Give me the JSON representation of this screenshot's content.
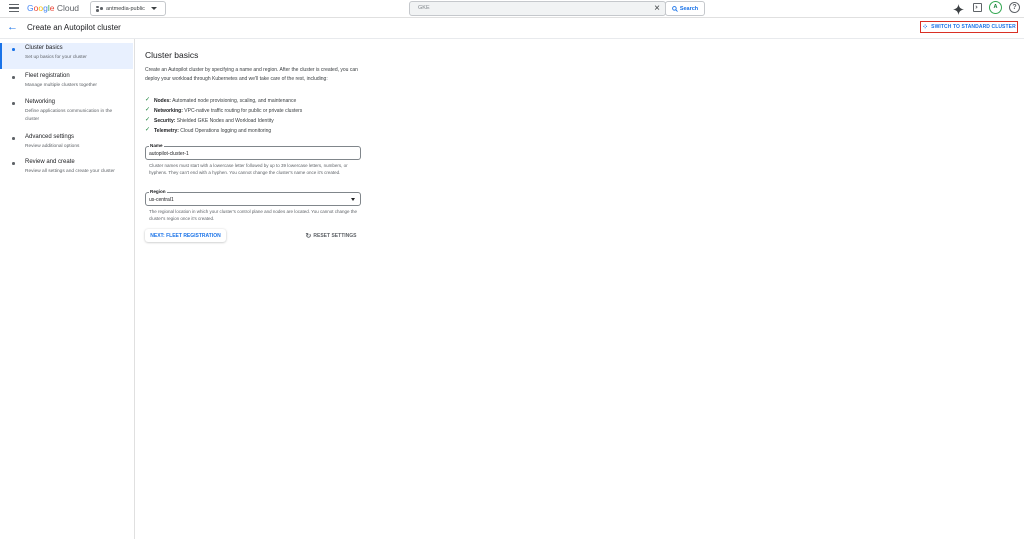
{
  "topbar": {
    "logo": {
      "g1": "G",
      "g2": "o",
      "g3": "o",
      "g4": "g",
      "g5": "l",
      "g6": "e",
      "cloud": "Cloud"
    },
    "project": "antmedia-public",
    "search_value": "GKE",
    "search_button": "Search",
    "avatar_letter": "A",
    "help_glyph": "?"
  },
  "titlebar": {
    "back_glyph": "←",
    "title": "Create an Autopilot cluster",
    "switch_button": "SWITCH TO STANDARD CLUSTER"
  },
  "steps": [
    {
      "title": "Cluster basics",
      "desc": "Set up basics for your cluster"
    },
    {
      "title": "Fleet registration",
      "desc": "Manage multiple clusters together"
    },
    {
      "title": "Networking",
      "desc": "Define applications communication in the cluster"
    },
    {
      "title": "Advanced settings",
      "desc": "Review additional options"
    },
    {
      "title": "Review and create",
      "desc": "Review all settings and create your cluster"
    }
  ],
  "main": {
    "heading": "Cluster basics",
    "intro": "Create an Autopilot cluster by specifying a name and region. After the cluster is created, you can deploy your workload through Kubernetes and we'll take care of the rest, including:",
    "features": [
      {
        "label": "Nodes:",
        "text": " Automated node provisioning, scaling, and maintenance"
      },
      {
        "label": "Networking:",
        "text": " VPC-native traffic routing for public or private clusters"
      },
      {
        "label": "Security:",
        "text": " Shielded GKE Nodes and Workload Identity"
      },
      {
        "label": "Telemetry:",
        "text": " Cloud Operations logging and monitoring"
      }
    ],
    "name_field": {
      "label": "Name",
      "value": "autopilot-cluster-1",
      "helper": "Cluster names must start with a lowercase letter followed by up to 39 lowercase letters, numbers, or hyphens. They can't end with a hyphen. You cannot change the cluster's name once it's created."
    },
    "region_field": {
      "label": "Region",
      "value": "us-central1",
      "helper": "The regional location in which your cluster's control plane and nodes are located. You cannot change the cluster's region once it's created."
    },
    "next_button": "NEXT: FLEET REGISTRATION",
    "reset_button": "RESET SETTINGS"
  },
  "colors": {
    "accent": "#1a73e8",
    "highlight": "#d93025",
    "check": "#188038"
  }
}
